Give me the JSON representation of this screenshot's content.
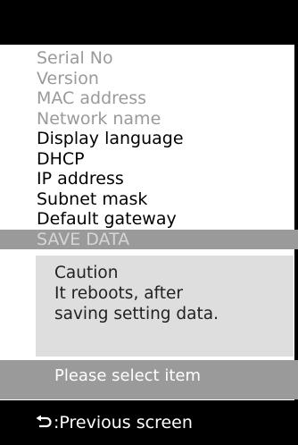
{
  "menu": {
    "items": [
      {
        "label": "Serial   No",
        "state": "disabled"
      },
      {
        "label": "Version",
        "state": "disabled"
      },
      {
        "label": "MAC address",
        "state": "disabled"
      },
      {
        "label": "Network name",
        "state": "disabled"
      },
      {
        "label": "Display language",
        "state": "enabled"
      },
      {
        "label": "DHCP",
        "state": "enabled"
      },
      {
        "label": "IP address",
        "state": "enabled"
      },
      {
        "label": "Subnet mask",
        "state": "enabled"
      },
      {
        "label": "Default gateway",
        "state": "enabled"
      },
      {
        "label": "SAVE DATA",
        "state": "selected"
      }
    ]
  },
  "caution": {
    "title": "Caution",
    "line1": "It reboots, after",
    "line2": "saving setting data."
  },
  "status": {
    "message": "Please select item"
  },
  "footer": {
    "back_label": ":Previous screen",
    "icon": "return-arrow-icon"
  },
  "colors": {
    "background": "#ffffff",
    "bar": "#000000",
    "disabled_text": "#9a9a9a",
    "highlight": "#9a9a9a",
    "caution_bg": "#dedede"
  }
}
